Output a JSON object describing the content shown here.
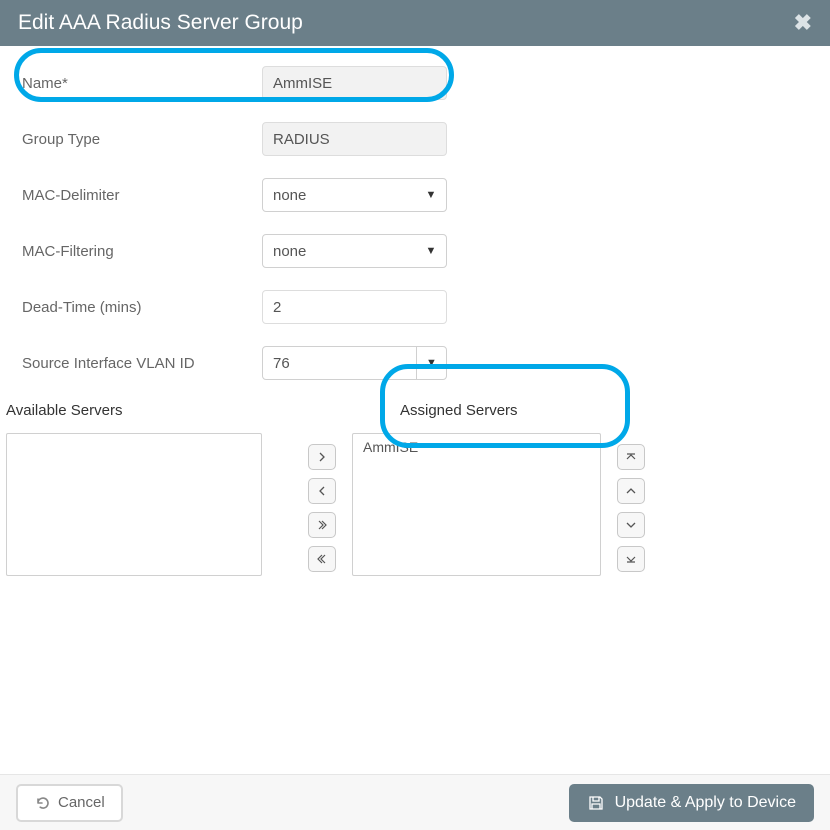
{
  "header": {
    "title": "Edit AAA Radius Server Group"
  },
  "fields": {
    "name": {
      "label": "Name*",
      "value": "AmmISE"
    },
    "group_type": {
      "label": "Group Type",
      "value": "RADIUS"
    },
    "mac_delimiter": {
      "label": "MAC-Delimiter",
      "value": "none"
    },
    "mac_filtering": {
      "label": "MAC-Filtering",
      "value": "none"
    },
    "dead_time": {
      "label": "Dead-Time (mins)",
      "value": "2"
    },
    "source_vlan": {
      "label": "Source Interface VLAN ID",
      "value": "76"
    }
  },
  "servers": {
    "available_label": "Available Servers",
    "assigned_label": "Assigned Servers",
    "available": [],
    "assigned": [
      "AmmISE"
    ]
  },
  "footer": {
    "cancel": "Cancel",
    "apply": "Update & Apply to Device"
  }
}
